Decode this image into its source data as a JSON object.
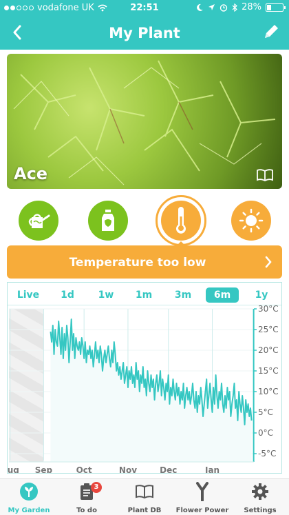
{
  "status_bar": {
    "carrier": "vodafone UK",
    "time": "22:51",
    "battery": "28%",
    "battery_level": 0.28
  },
  "nav": {
    "back_icon": "chevron-left-icon",
    "title": "My Plant",
    "edit_icon": "pencil-icon"
  },
  "plant": {
    "name": "Ace"
  },
  "sensors": [
    {
      "name": "watering-can-icon",
      "color": "#7cc21e"
    },
    {
      "name": "fertilizer-bottle-icon",
      "color": "#7cc21e"
    },
    {
      "name": "thermometer-icon",
      "color": "#f7ac3a",
      "selected": true
    },
    {
      "name": "sun-icon",
      "color": "#f7ac3a"
    }
  ],
  "alert": {
    "text": "Temperature too low",
    "color": "#f7ac3a"
  },
  "ranges": [
    {
      "label": "Live",
      "active": false
    },
    {
      "label": "1d",
      "active": false
    },
    {
      "label": "1w",
      "active": false
    },
    {
      "label": "1m",
      "active": false
    },
    {
      "label": "3m",
      "active": false
    },
    {
      "label": "6m",
      "active": true
    },
    {
      "label": "1y",
      "active": false
    }
  ],
  "chart_data": {
    "type": "line",
    "color": "#35c7c2",
    "ylim": [
      -5,
      30
    ],
    "y_ticks": [
      "30°C",
      "25°C",
      "20°C",
      "15°C",
      "10°C",
      "5°C",
      "0°C",
      "-5°C"
    ],
    "x_ticks": [
      "Aug",
      "Sep",
      "Oct",
      "Nov",
      "Dec",
      "Jan"
    ],
    "x": [
      0.0,
      1.0,
      2.0,
      3.0,
      4.0,
      5.0,
      6.0,
      7.0,
      8.0,
      9.0,
      10.0,
      11.0,
      12.0,
      13.0,
      14.0,
      15.0,
      16.0,
      17.0,
      18.0,
      19.0,
      20.0,
      21.0,
      22.0,
      23.0,
      24.0,
      25.0,
      26.0,
      27.0,
      28.0,
      29.0,
      30.0,
      31.0,
      32.0,
      33.0,
      34.0,
      35.0,
      36.0,
      37.0,
      38.0,
      39.0,
      40.0,
      41.0,
      42.0,
      43.0,
      44.0,
      45.0,
      46.0,
      47.0,
      48.0,
      49.0,
      50.0,
      51.0,
      52.0,
      53.0,
      54.0,
      55.0,
      56.0,
      57.0,
      58.0,
      59.0,
      60.0,
      61.0,
      62.0,
      63.0,
      64.0,
      65.0,
      66.0,
      67.0,
      68.0,
      69.0,
      70.0,
      71.0,
      72.0,
      73.0,
      74.0,
      75.0,
      76.0,
      77.0,
      78.0,
      79.0,
      80.0,
      81.0,
      82.0,
      83.0,
      84.0,
      85.0,
      86.0,
      87.0,
      88.0,
      89.0,
      90.0,
      91.0,
      92.0,
      93.0,
      94.0,
      95.0,
      96.0,
      97.0,
      98.0,
      99.0,
      100.0,
      101.0,
      102.0,
      103.0,
      104.0,
      105.0,
      106.0,
      107.0,
      108.0,
      109.0,
      110.0,
      111.0,
      112.0,
      113.0,
      114.0,
      115.0,
      116.0,
      117.0,
      118.0,
      119.0,
      120.0,
      121.0,
      122.0,
      123.0,
      124.0,
      125.0,
      126.0,
      127.0,
      128.0,
      129.0,
      130.0,
      131.0,
      132.0,
      133.0,
      134.0,
      135.0,
      136.0,
      137.0,
      138.0,
      139.0,
      140.0,
      141.0,
      142.0,
      143.0,
      144.0,
      145.0,
      146.0,
      147.0,
      148.0,
      149.0,
      150.0,
      151.0,
      152.0,
      153.0,
      154.0,
      155.0,
      156.0,
      157.0,
      158.0,
      159.0,
      160.0,
      161.0,
      162.0,
      163.0,
      164.0,
      165.0,
      166.0,
      167.0,
      168.0,
      169.0,
      170.0,
      171.0,
      172.0,
      173.0,
      174.0
    ],
    "x_min": -36.0,
    "x_max": 176.0,
    "x_tick_positions": [
      -35.0,
      -6.0,
      29.0,
      67.0,
      102.0,
      140.0
    ],
    "shaded_region": [
      -36.0,
      -6.0
    ],
    "values": [
      24.5,
      22,
      26,
      19,
      25,
      22,
      21,
      27,
      23,
      19,
      25.5,
      18,
      24,
      20,
      26,
      23,
      17,
      22,
      27.5,
      20,
      24,
      18,
      23,
      21,
      20,
      22,
      19,
      23,
      21,
      18,
      22,
      17,
      20,
      19,
      21,
      18,
      20,
      16,
      19,
      22,
      18,
      20,
      17,
      21,
      19,
      15,
      18,
      20,
      17,
      19,
      21,
      18,
      16,
      20,
      17,
      22,
      19,
      15,
      17,
      14,
      16,
      13,
      15,
      17,
      12,
      14,
      16,
      11,
      15,
      13,
      16,
      12,
      14,
      11,
      17,
      13,
      15,
      10,
      14,
      12,
      16,
      11,
      13,
      9,
      15,
      12,
      10,
      14,
      11,
      13,
      8,
      12,
      14,
      10,
      12,
      15,
      9,
      13,
      11,
      8,
      12,
      10,
      14,
      7,
      11,
      9,
      13,
      10,
      8,
      12,
      9,
      11,
      7,
      10,
      8,
      12,
      6,
      9,
      11,
      8,
      10,
      7,
      9,
      12,
      8,
      6,
      10,
      5,
      9,
      7,
      11,
      8,
      4,
      7,
      10,
      13,
      6,
      9,
      12,
      8,
      5,
      11,
      7,
      14,
      9,
      6,
      10,
      8,
      12,
      7,
      5,
      9,
      6,
      11,
      8,
      10,
      4,
      7,
      9,
      12,
      6,
      8,
      3,
      10,
      7,
      5,
      9,
      6,
      2,
      8,
      5,
      7,
      4,
      6,
      3,
      5,
      4,
      6
    ]
  },
  "tabs": [
    {
      "label": "My Garden",
      "icon": "plant-icon",
      "active": true
    },
    {
      "label": "To do",
      "icon": "clipboard-icon",
      "badge": "3",
      "active": false
    },
    {
      "label": "Plant DB",
      "icon": "book-icon",
      "active": false
    },
    {
      "label": "Flower Power",
      "icon": "sensor-icon",
      "active": false
    },
    {
      "label": "Settings",
      "icon": "gear-icon",
      "active": false
    }
  ]
}
